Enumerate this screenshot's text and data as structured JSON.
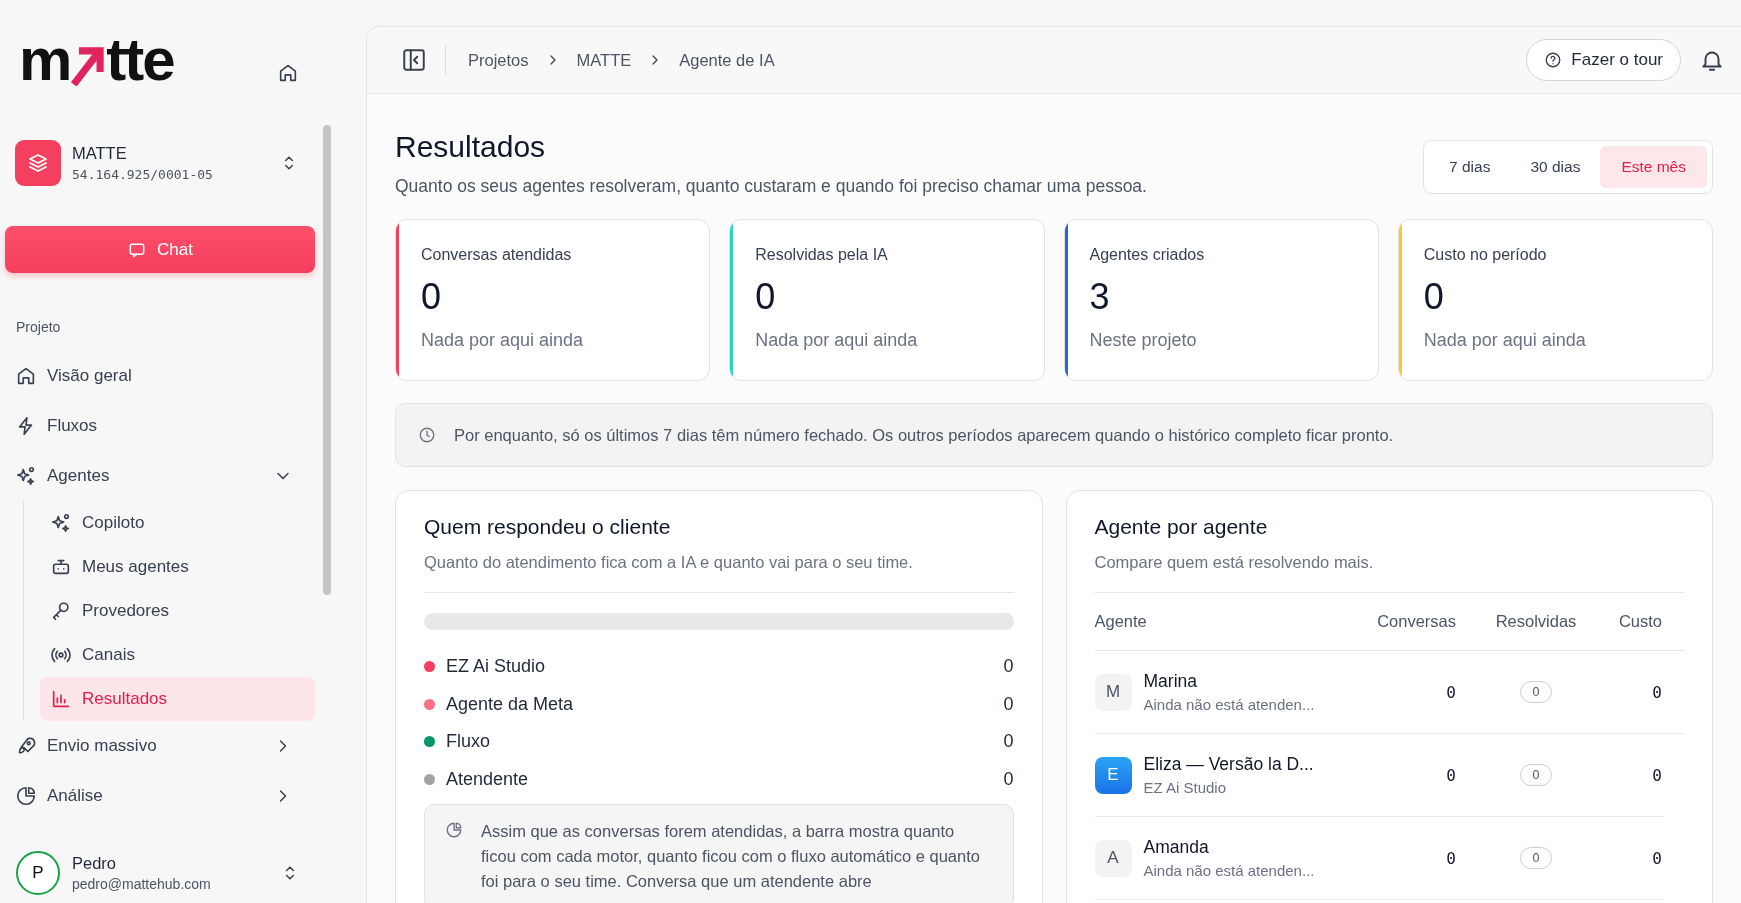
{
  "sidebar": {
    "logo": {
      "left": "m",
      "right": "tte"
    },
    "org": {
      "name": "MATTE",
      "id": "54.164.925/0001-05"
    },
    "chat_button": "Chat",
    "section": "Projeto",
    "items": [
      {
        "label": "Visão geral",
        "selected": false
      },
      {
        "label": "Fluxos",
        "selected": false
      },
      {
        "label": "Agentes",
        "selected": false,
        "expanded": true,
        "children": [
          {
            "label": "Copiloto",
            "selected": false
          },
          {
            "label": "Meus agentes",
            "selected": false
          },
          {
            "label": "Provedores",
            "selected": false
          },
          {
            "label": "Canais",
            "selected": false
          },
          {
            "label": "Resultados",
            "selected": true
          }
        ]
      },
      {
        "label": "Envio massivo",
        "selected": false,
        "expanded": false
      },
      {
        "label": "Análise",
        "selected": false,
        "expanded": false
      }
    ],
    "user": {
      "initial": "P",
      "name": "Pedro",
      "email": "pedro@mattehub.com"
    }
  },
  "header": {
    "breadcrumbs": [
      "Projetos",
      "MATTE",
      "Agente de IA"
    ],
    "tour_button": "Fazer o tour"
  },
  "page": {
    "title": "Resultados",
    "subtitle": "Quanto os seus agentes resolveram, quanto custaram e quando foi preciso chamar uma pessoa.",
    "periods": [
      {
        "label": "7 dias",
        "selected": false
      },
      {
        "label": "30 dias",
        "selected": false
      },
      {
        "label": "Este mês",
        "selected": true
      }
    ]
  },
  "stats": [
    {
      "label": "Conversas atendidas",
      "value": "0",
      "note": "Nada por aqui ainda",
      "color": "#f43f5e"
    },
    {
      "label": "Resolvidas pela IA",
      "value": "0",
      "note": "Nada por aqui ainda",
      "color": "#2dd4bf"
    },
    {
      "label": "Agentes criados",
      "value": "3",
      "note": "Neste projeto",
      "color": "#2563eb"
    },
    {
      "label": "Custo no período",
      "value": "0",
      "note": "Nada por aqui ainda",
      "color": "#facc15"
    }
  ],
  "notice": "Por enquanto, só os últimos 7 dias têm número fechado. Os outros períodos aparecem quando o histórico completo ficar pronto.",
  "responders": {
    "title": "Quem respondeu o cliente",
    "subtitle": "Quanto do atendimento fica com a IA e quanto vai para o seu time.",
    "legend": [
      {
        "label": "EZ Ai Studio",
        "value": "0",
        "color": "#f43f5e"
      },
      {
        "label": "Agente da Meta",
        "value": "0",
        "color": "#fb7185"
      },
      {
        "label": "Fluxo",
        "value": "0",
        "color": "#059669"
      },
      {
        "label": "Atendente",
        "value": "0",
        "color": "#a3a3a3"
      }
    ],
    "info": "Assim que as conversas forem atendidas, a barra mostra quanto ficou com cada motor, quanto ficou com o fluxo automático e quanto foi para o seu time. Conversa que um atendente abre"
  },
  "agents": {
    "title": "Agente por agente",
    "subtitle": "Compare quem está resolvendo mais.",
    "columns": [
      "Agente",
      "Conversas",
      "Resolvidas",
      "Custo"
    ],
    "rows": [
      {
        "initial": "M",
        "kind": "plain",
        "name": "Marina",
        "subtitle": "Ainda não está atenden...",
        "conversations": "0",
        "resolved": "0",
        "cost": "0"
      },
      {
        "initial": "E",
        "kind": "filled",
        "name": "Eliza — Versão la D...",
        "subtitle": "EZ Ai Studio",
        "conversations": "0",
        "resolved": "0",
        "cost": "0"
      },
      {
        "initial": "A",
        "kind": "plain",
        "name": "Amanda",
        "subtitle": "Ainda não está atenden...",
        "conversations": "0",
        "resolved": "0",
        "cost": "0"
      }
    ]
  }
}
